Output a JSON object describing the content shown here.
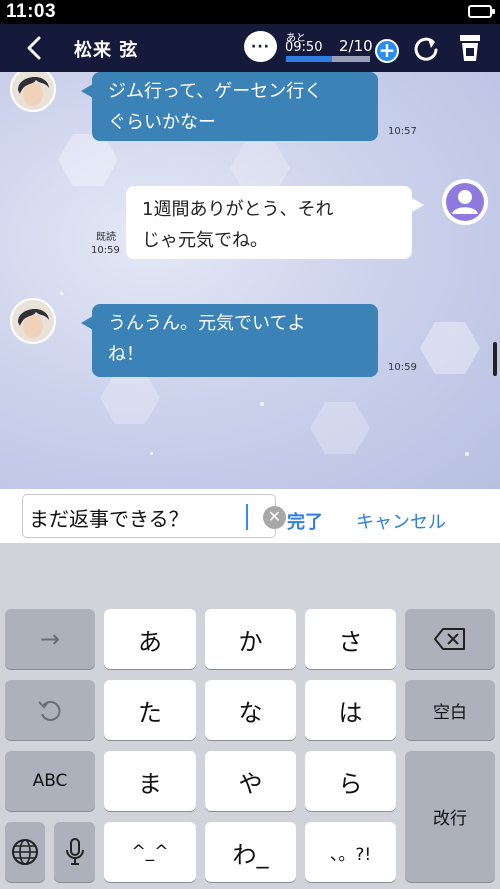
{
  "status_bar": {
    "time": "11:03"
  },
  "header": {
    "contact_name": "松来 弦",
    "more_label": "···",
    "remaining_label": "あと",
    "remaining_time": "09:50",
    "message_count": "2/10",
    "progress_fraction": 0.55,
    "accent_color": "#2a8ef0",
    "icons": [
      "back-icon",
      "more-icon",
      "plus-icon",
      "refresh-icon",
      "app-icon"
    ]
  },
  "messages": [
    {
      "sender": "contact",
      "text_line1": "ジム行って、ゲーセン行く",
      "text_line2": "ぐらいかなー",
      "time": "10:57"
    },
    {
      "sender": "self",
      "text_line1": "1週間ありがとう、それ",
      "text_line2": "じゃ元気でね。",
      "read": "既読",
      "time": "10:59"
    },
    {
      "sender": "contact",
      "text_line1": "うんうん。元気でいてよ",
      "text_line2": "ね！",
      "time": "10:59"
    }
  ],
  "input": {
    "value": "まだ返事できる？",
    "done_label": "完了",
    "cancel_label": "キャンセル"
  },
  "keyboard": {
    "rows": [
      [
        "→",
        "あ",
        "か",
        "さ",
        "⌫"
      ],
      [
        "↺",
        "た",
        "な",
        "は",
        "空白"
      ],
      [
        "ABC",
        "ま",
        "や",
        "ら",
        "改行"
      ],
      [
        "🌐",
        "🎤",
        "^_^",
        "わ_",
        "、。?!"
      ]
    ]
  }
}
